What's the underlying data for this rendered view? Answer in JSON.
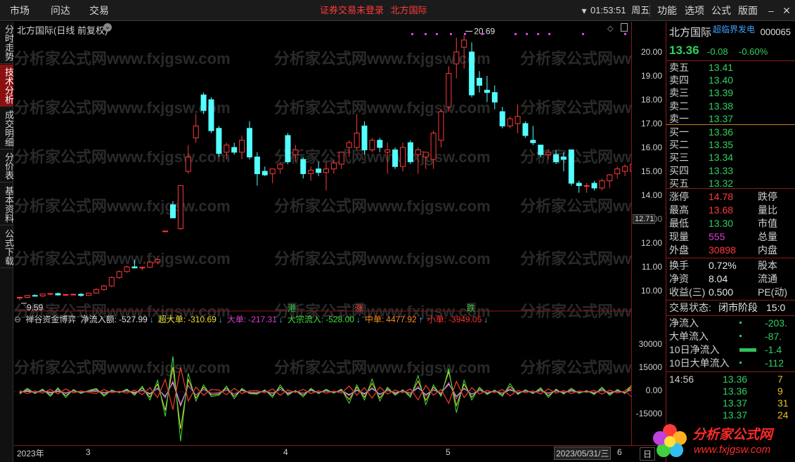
{
  "topbar": {
    "nav": [
      "市场",
      "问达",
      "交易"
    ],
    "notice_login": "证券交易未登录",
    "notice_stock": "北方国际",
    "time": "01:53:51",
    "weekday": "周五",
    "menu": [
      "功能",
      "选项",
      "公式",
      "版面"
    ]
  },
  "left_tabs": [
    "分时走势",
    "技术分析",
    "成交明细",
    "分价表",
    "基本资料",
    "公式下载"
  ],
  "chart": {
    "title": "北方国际(日线 前复权)",
    "watermark": "分析家公式网www.fxjgsw.com",
    "high_label": "20.69",
    "low_label": "9.59",
    "cursor_price": "12.71",
    "y_ticks": [
      "20.00",
      "19.00",
      "18.00",
      "17.00",
      "16.00",
      "15.00",
      "14.00",
      "13.00",
      "12.00",
      "11.00",
      "10.00"
    ],
    "event_marks": [
      "港",
      "涨",
      "跌"
    ],
    "candles": [
      [
        9.7,
        9.75,
        9.6,
        9.72
      ],
      [
        9.72,
        9.82,
        9.68,
        9.8
      ],
      [
        9.8,
        9.85,
        9.75,
        9.78
      ],
      [
        9.78,
        9.88,
        9.74,
        9.86
      ],
      [
        9.86,
        9.9,
        9.82,
        9.88
      ],
      [
        9.88,
        9.92,
        9.8,
        9.82
      ],
      [
        9.82,
        9.85,
        9.78,
        9.84
      ],
      [
        9.84,
        9.88,
        9.8,
        9.85
      ],
      [
        9.85,
        9.9,
        9.75,
        9.8
      ],
      [
        9.8,
        9.92,
        9.78,
        9.9
      ],
      [
        9.9,
        10.1,
        9.88,
        10.05
      ],
      [
        10.05,
        10.25,
        10.0,
        10.2
      ],
      [
        10.2,
        10.6,
        10.15,
        10.55
      ],
      [
        10.55,
        10.85,
        10.5,
        10.8
      ],
      [
        10.8,
        11.05,
        10.75,
        11.0
      ],
      [
        11.0,
        11.3,
        10.95,
        10.95
      ],
      [
        10.95,
        11.0,
        10.85,
        10.98
      ],
      [
        10.98,
        11.25,
        10.95,
        11.2
      ],
      [
        11.2,
        11.35,
        11.1,
        11.3
      ],
      [
        12.5,
        12.5,
        12.5,
        12.5
      ],
      [
        13.6,
        13.75,
        13.2,
        13.05
      ],
      [
        12.6,
        14.4,
        12.55,
        14.4
      ],
      [
        15.0,
        16.1,
        14.9,
        15.6
      ],
      [
        16.4,
        17.4,
        16.2,
        16.9
      ],
      [
        18.2,
        18.3,
        17.4,
        17.55
      ],
      [
        18.0,
        18.1,
        16.6,
        16.7
      ],
      [
        16.8,
        16.9,
        15.6,
        15.75
      ],
      [
        15.8,
        16.2,
        15.5,
        16.1
      ],
      [
        16.0,
        16.2,
        15.7,
        15.8
      ],
      [
        15.8,
        16.5,
        15.5,
        16.3
      ],
      [
        16.8,
        17.1,
        15.5,
        15.6
      ],
      [
        15.6,
        15.8,
        14.4,
        14.9
      ],
      [
        15.0,
        15.2,
        14.8,
        14.85
      ],
      [
        14.9,
        15.1,
        14.5,
        15.1
      ],
      [
        15.1,
        15.4,
        14.9,
        15.3
      ],
      [
        16.5,
        16.6,
        15.3,
        15.4
      ],
      [
        15.7,
        16.1,
        15.4,
        15.9
      ],
      [
        15.5,
        15.6,
        14.7,
        14.9
      ],
      [
        14.9,
        15.2,
        14.6,
        15.05
      ],
      [
        15.1,
        15.4,
        14.8,
        14.95
      ],
      [
        14.95,
        15.4,
        14.2,
        15.1
      ],
      [
        15.1,
        15.5,
        14.9,
        15.35
      ],
      [
        15.3,
        15.8,
        15.1,
        15.8
      ],
      [
        16.0,
        16.3,
        15.6,
        16.2
      ],
      [
        16.0,
        17.4,
        15.9,
        16.6
      ],
      [
        16.9,
        17.1,
        15.7,
        15.9
      ],
      [
        15.9,
        16.4,
        15.8,
        16.3
      ],
      [
        16.3,
        16.4,
        15.8,
        16.0
      ],
      [
        15.8,
        16.2,
        14.9,
        15.9
      ],
      [
        15.9,
        16.0,
        15.1,
        15.2
      ],
      [
        15.2,
        16.2,
        15.0,
        16.0
      ],
      [
        16.2,
        16.3,
        15.3,
        15.4
      ],
      [
        15.7,
        16.0,
        14.9,
        15.9
      ],
      [
        15.6,
        15.8,
        15.1,
        15.8
      ],
      [
        15.5,
        16.7,
        15.1,
        16.6
      ],
      [
        16.3,
        17.6,
        16.0,
        17.5
      ],
      [
        17.7,
        19.4,
        17.5,
        19.1
      ],
      [
        19.5,
        20.6,
        18.9,
        20.0
      ],
      [
        20.2,
        20.69,
        19.3,
        20.5
      ],
      [
        20.0,
        20.4,
        18.1,
        18.2
      ],
      [
        18.9,
        19.2,
        18.3,
        18.6
      ],
      [
        18.4,
        19.0,
        17.9,
        18.3
      ],
      [
        18.3,
        18.6,
        17.6,
        17.9
      ],
      [
        17.5,
        17.7,
        16.8,
        16.9
      ],
      [
        16.9,
        17.3,
        16.8,
        17.2
      ],
      [
        17.0,
        17.8,
        16.6,
        17.3
      ],
      [
        17.0,
        17.1,
        16.4,
        16.5
      ],
      [
        16.3,
        16.9,
        16.1,
        16.2
      ],
      [
        16.1,
        16.1,
        15.6,
        15.7
      ],
      [
        15.7,
        15.9,
        15.5,
        15.8
      ],
      [
        15.7,
        15.9,
        15.3,
        15.4
      ],
      [
        15.6,
        15.8,
        15.0,
        15.5
      ],
      [
        15.9,
        15.9,
        14.4,
        14.5
      ],
      [
        14.5,
        14.6,
        14.1,
        14.4
      ],
      [
        14.4,
        14.5,
        14.1,
        14.4
      ],
      [
        14.5,
        14.6,
        14.2,
        14.3
      ],
      [
        14.3,
        14.7,
        14.2,
        14.6
      ],
      [
        14.6,
        14.9,
        14.3,
        14.85
      ],
      [
        14.9,
        15.2,
        14.7,
        15.1
      ],
      [
        15.0,
        15.3,
        14.8,
        15.2
      ],
      [
        15.0,
        15.5,
        14.9,
        15.3
      ]
    ]
  },
  "indicator": {
    "name": "禅谷资金博弈",
    "fields": [
      {
        "label": "净流入额:",
        "value": "-527.99",
        "arrow": "↓",
        "color": "#e0e0e0"
      },
      {
        "label": "超大单:",
        "value": "-310.69",
        "arrow": "↓",
        "color": "#e8e030"
      },
      {
        "label": "大单:",
        "value": "-217.31",
        "arrow": "↓",
        "color": "#d040d0"
      },
      {
        "label": "大宗流入:",
        "value": "-528.00",
        "arrow": "↓",
        "color": "#40e040"
      },
      {
        "label": "中单:",
        "value": "4477.92",
        "arrow": "↑",
        "color": "#ff8c1a"
      },
      {
        "label": "小单:",
        "value": "-3949.05",
        "arrow": "↓",
        "color": "#ff3030"
      }
    ],
    "y_ticks": [
      "30000",
      "15000",
      "0.00",
      "-15000"
    ],
    "series": [
      {
        "name": "净流入额",
        "color": "#e0e0e0",
        "values": [
          -200,
          300,
          -500,
          600,
          -300,
          200,
          -800,
          500,
          -300,
          200,
          400,
          -600,
          300,
          -200,
          500,
          -400,
          800,
          -1200,
          2000,
          -3000,
          6000,
          -9000,
          4000,
          -2000,
          1500,
          -1000,
          -700,
          1200,
          -1500,
          800,
          -500,
          -600,
          400,
          -900,
          1500,
          -700,
          300,
          -1000,
          800,
          -400,
          500,
          -300,
          600,
          -1800,
          900,
          -1200,
          2000,
          -1500,
          800,
          -600,
          400,
          -900,
          2500,
          -1800,
          1200,
          -800,
          5000,
          -3000,
          2000,
          -1500,
          900,
          -600,
          300,
          -800,
          1200,
          -500,
          400,
          -300,
          700,
          -900,
          500,
          -400,
          600,
          -300,
          200,
          -500,
          800,
          -600,
          400,
          -300,
          1500
        ]
      },
      {
        "name": "超大单",
        "color": "#e8e030",
        "values": [
          -1000,
          1500,
          -800,
          1200,
          -2000,
          1800,
          -2500,
          1000,
          -700,
          500,
          1500,
          -2000,
          800,
          -400,
          1200,
          -1500,
          2500,
          -3500,
          5000,
          -12000,
          16000,
          -24000,
          8000,
          -4000,
          3000,
          -2000,
          -1500,
          2500,
          -3000,
          1500,
          -800,
          -1000,
          900,
          -2500,
          3000,
          -1500,
          600,
          -2200,
          1500,
          -800,
          1100,
          -600,
          1200,
          -5000,
          3000,
          -3500,
          5500,
          -4000,
          2000,
          -1500,
          900,
          -2500,
          7000,
          -5500,
          3000,
          -2000,
          13000,
          -9000,
          5000,
          -3500,
          2000,
          -1200,
          800,
          -2000,
          3500,
          -1200,
          900,
          -800,
          1800,
          -2500,
          1200,
          -1000,
          1500,
          -700,
          500,
          -1200,
          2000,
          -1500,
          1000,
          -800,
          3500
        ]
      },
      {
        "name": "大单",
        "color": "#d040d0",
        "values": [
          -500,
          800,
          -400,
          600,
          -1000,
          900,
          -1200,
          500,
          -400,
          300,
          700,
          -900,
          400,
          -200,
          600,
          -800,
          1200,
          -1800,
          2500,
          -4000,
          7000,
          -8000,
          4000,
          -2000,
          1500,
          -1000,
          -800,
          1200,
          -1500,
          800,
          -400,
          -500,
          400,
          -1200,
          1500,
          -800,
          300,
          -1100,
          800,
          -400,
          600,
          -300,
          600,
          -2500,
          1500,
          -1800,
          2800,
          -2000,
          1000,
          -800,
          500,
          -1200,
          3500,
          -2800,
          1500,
          -1000,
          6000,
          -4500,
          2500,
          -1800,
          1000,
          -600,
          400,
          -1000,
          1800,
          -600,
          500,
          -400,
          900,
          -1200,
          600,
          -500,
          800,
          -400,
          300,
          -600,
          1000,
          -800,
          500,
          -400,
          1800
        ]
      },
      {
        "name": "大宗流入",
        "color": "#40e040",
        "values": [
          -1500,
          2300,
          -1200,
          1800,
          -3000,
          2700,
          -3700,
          1500,
          -1100,
          800,
          2200,
          -2900,
          1200,
          -600,
          1800,
          -2300,
          3700,
          -5300,
          7500,
          -16000,
          23000,
          -32000,
          12000,
          -6000,
          4500,
          -3000,
          -2300,
          3700,
          -4500,
          2300,
          -1200,
          -1500,
          1300,
          -3700,
          4500,
          -2300,
          900,
          -3300,
          2300,
          -1200,
          1700,
          -900,
          1800,
          -7500,
          4500,
          -5300,
          8300,
          -6000,
          3000,
          -2300,
          1400,
          -3700,
          10500,
          -8300,
          4500,
          -3000,
          15000,
          -13500,
          7500,
          -5300,
          3000,
          -1800,
          1200,
          -3000,
          5300,
          -1800,
          1400,
          -1200,
          2700,
          -3700,
          1800,
          -1500,
          2300,
          -1100,
          800,
          -1800,
          3000,
          -2300,
          1500,
          -1200,
          5300
        ]
      },
      {
        "name": "中单",
        "color": "#ff8c1a",
        "values": [
          800,
          -1200,
          600,
          -900,
          1500,
          -1300,
          1800,
          -700,
          500,
          -400,
          -1100,
          1400,
          -600,
          300,
          -900,
          1100,
          -1800,
          2600,
          -3700,
          8000,
          -11500,
          16000,
          -6000,
          3000,
          -2200,
          1500,
          1100,
          -1800,
          2200,
          -1100,
          600,
          700,
          -600,
          1800,
          -2200,
          1100,
          -400,
          1600,
          -1100,
          600,
          -800,
          400,
          -900,
          3700,
          -2200,
          2600,
          -4100,
          3000,
          -1500,
          1100,
          -700,
          1800,
          -5200,
          4100,
          -2200,
          1500,
          -7500,
          6700,
          -3700,
          2600,
          -1500,
          900,
          -600,
          1500,
          -2600,
          900,
          -700,
          600,
          -1300,
          1800,
          -900,
          700,
          -1100,
          500,
          -400,
          900,
          -1500,
          1100,
          -700,
          600,
          4477
        ]
      },
      {
        "name": "小单",
        "color": "#ff3030",
        "values": [
          700,
          -1100,
          600,
          -900,
          1500,
          -1400,
          1900,
          -800,
          600,
          -400,
          -1100,
          1500,
          -600,
          300,
          -900,
          1200,
          -1900,
          2700,
          -3800,
          8000,
          -11500,
          16000,
          -6000,
          3000,
          -2300,
          1500,
          1200,
          -1900,
          2300,
          -1200,
          600,
          800,
          -700,
          1900,
          -2300,
          1200,
          -500,
          1700,
          -1200,
          600,
          -900,
          500,
          -900,
          3800,
          -2300,
          2700,
          -4200,
          3000,
          -1500,
          1200,
          -700,
          1900,
          -5300,
          4200,
          -2300,
          1500,
          -7500,
          6800,
          -3800,
          2700,
          -1500,
          900,
          -600,
          1500,
          -2700,
          900,
          -700,
          600,
          -1400,
          1900,
          -900,
          800,
          -1200,
          600,
          -400,
          900,
          -1500,
          1200,
          -800,
          600,
          -3949
        ]
      }
    ]
  },
  "x_axis": {
    "labels": [
      "2023年",
      "3",
      "4",
      "5",
      "6",
      "日"
    ],
    "cursor_date": "2023/05/31/三"
  },
  "quote": {
    "name": "北方国际",
    "subtitle": "超临界发电",
    "code": "000065",
    "price": "13.36",
    "change": "-0.08",
    "change_pct": "-0.60%",
    "asks": [
      {
        "label": "卖五",
        "price": "13.41"
      },
      {
        "label": "卖四",
        "price": "13.40"
      },
      {
        "label": "卖三",
        "price": "13.39"
      },
      {
        "label": "卖二",
        "price": "13.38"
      },
      {
        "label": "卖一",
        "price": "13.37"
      }
    ],
    "bids": [
      {
        "label": "买一",
        "price": "13.36"
      },
      {
        "label": "买二",
        "price": "13.35"
      },
      {
        "label": "买三",
        "price": "13.34"
      },
      {
        "label": "买四",
        "price": "13.33"
      },
      {
        "label": "买五",
        "price": "13.32"
      }
    ],
    "stats": [
      {
        "label": "涨停",
        "value": "14.78",
        "color": "red",
        "right": "跌停"
      },
      {
        "label": "最高",
        "value": "13.68",
        "color": "red",
        "right": "量比"
      },
      {
        "label": "最低",
        "value": "13.30",
        "color": "green",
        "right": "市值"
      },
      {
        "label": "现量",
        "value": "555",
        "color": "purple",
        "right": "总量"
      },
      {
        "label": "外盘",
        "value": "30898",
        "color": "red",
        "right": "内盘"
      }
    ],
    "stats2": [
      {
        "label": "换手",
        "value": "0.72%",
        "right": "股本"
      },
      {
        "label": "净资",
        "value": "8.04",
        "right": "流通"
      },
      {
        "label": "收益(三)",
        "value": "0.500",
        "right": "PE(动)"
      }
    ],
    "trade_status_label": "交易状态:",
    "trade_status": "闭市阶段",
    "trade_status_time": "15:0",
    "flows": [
      {
        "label": "净流入",
        "value": "-203."
      },
      {
        "label": "大单流入",
        "value": "-87."
      },
      {
        "label": "10日净流入",
        "value": "-1.4"
      },
      {
        "label": "10日大单流入",
        "value": "-112"
      }
    ],
    "ticks": [
      {
        "time": "14:56",
        "price": "13.36",
        "vol": "7"
      },
      {
        "time": "",
        "price": "13.36",
        "vol": "9"
      },
      {
        "time": "",
        "price": "13.37",
        "vol": "31"
      },
      {
        "time": "",
        "price": "13.37",
        "vol": "24"
      }
    ]
  },
  "logo": {
    "name": "分析家公式网",
    "url": "www.fxjgsw.com"
  }
}
